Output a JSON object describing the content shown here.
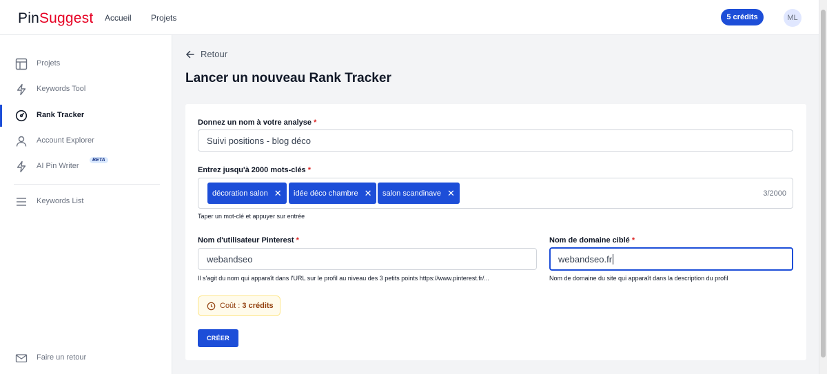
{
  "header": {
    "logo_part1": "Pin",
    "logo_part2": "Suggest",
    "nav": [
      {
        "label": "Accueil"
      },
      {
        "label": "Projets"
      }
    ],
    "credits_label": "5 crédits",
    "avatar_initials": "ML"
  },
  "sidebar": {
    "items": [
      {
        "label": "Projets",
        "icon": "layout-icon"
      },
      {
        "label": "Keywords Tool",
        "icon": "lightning-icon"
      },
      {
        "label": "Rank Tracker",
        "icon": "gauge-icon",
        "active": true
      },
      {
        "label": "Account Explorer",
        "icon": "user-icon"
      },
      {
        "label": "AI Pin Writer",
        "icon": "lightning-icon",
        "badge": "BETA"
      },
      {
        "label": "Keywords List",
        "icon": "menu-icon"
      }
    ],
    "footer": {
      "label": "Faire un retour",
      "icon": "mail-icon"
    }
  },
  "main": {
    "back_label": "Retour",
    "title": "Lancer un nouveau Rank Tracker",
    "form": {
      "name_label": "Donnez un nom à votre analyse",
      "name_value": "Suivi positions - blog déco",
      "keywords_label": "Entrez jusqu'à 2000 mots-clés",
      "tags": [
        "décoration salon",
        "idée déco chambre",
        "salon scandinave"
      ],
      "keyword_counter": "3/2000",
      "keywords_help": "Taper un mot-clé et appuyer sur entrée",
      "pinterest_label": "Nom d'utilisateur Pinterest",
      "pinterest_value": "webandseo",
      "pinterest_help": "Il s'agit du nom qui apparaît dans l'URL sur le profil au niveau des 3 petits points https://www.pinterest.fr/...",
      "domain_label": "Nom de domaine ciblé",
      "domain_value": "webandseo.fr",
      "domain_help": "Nom de domaine du site qui apparaît dans la description du profil",
      "required_marker": "*",
      "cost_prefix": "Coût : ",
      "cost_value": "3 crédits",
      "submit_label": "CRÉER"
    }
  },
  "colors": {
    "primary": "#1d4ed8",
    "logo_accent": "#e60023",
    "required": "#dc2626",
    "cost_bg": "#fffbeb"
  }
}
